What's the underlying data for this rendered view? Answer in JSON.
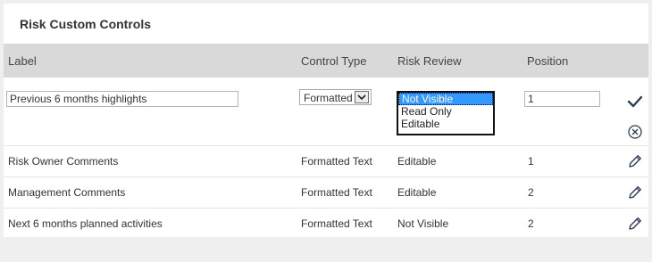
{
  "panel": {
    "title": "Risk Custom Controls"
  },
  "columns": {
    "label": "Label",
    "control_type": "Control Type",
    "risk_review": "Risk Review",
    "position": "Position"
  },
  "edit_row": {
    "label_value": "Previous 6 months highlights",
    "control_type_selected": "Formatted Text",
    "risk_review_options": [
      "Not Visible",
      "Read Only",
      "Editable"
    ],
    "risk_review_selected": "Not Visible",
    "position_value": "1",
    "save_icon": "checkmark-icon",
    "cancel_icon": "cancel-circle-icon"
  },
  "rows": [
    {
      "label": "Risk Owner Comments",
      "control_type": "Formatted Text",
      "risk_review": "Editable",
      "position": "1",
      "action_icon": "edit-pencil-icon"
    },
    {
      "label": "Management Comments",
      "control_type": "Formatted Text",
      "risk_review": "Editable",
      "position": "2",
      "action_icon": "edit-pencil-icon"
    },
    {
      "label": "Next 6 months planned activities",
      "control_type": "Formatted Text",
      "risk_review": "Not Visible",
      "position": "2",
      "action_icon": "edit-pencil-icon"
    }
  ],
  "colors": {
    "background": "#efefef",
    "header_bg": "#d9d9d9",
    "icon_color": "#2c3e55",
    "selection": "#3399ff"
  }
}
